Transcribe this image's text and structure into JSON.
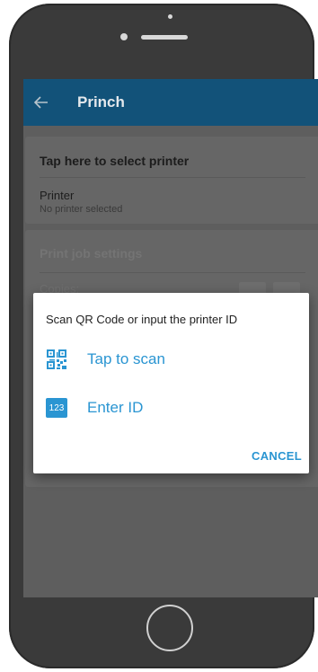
{
  "app_bar": {
    "title": "Princh",
    "back_icon": "arrow-left-icon",
    "color": "#125279"
  },
  "printer_card": {
    "title": "Tap here to select printer",
    "label": "Printer",
    "status": "No printer selected"
  },
  "print_settings_card": {
    "title": "Print job settings",
    "copies_label": "Copies:"
  },
  "dialog": {
    "title": "Scan QR Code or input the printer ID",
    "options": [
      {
        "label": "Tap to scan",
        "icon": "qr-code-icon"
      },
      {
        "label": "Enter ID",
        "icon": "numeric-123-icon",
        "icon_text": "123"
      }
    ],
    "cancel_label": "CANCEL",
    "accent_color": "#2a95d2"
  }
}
